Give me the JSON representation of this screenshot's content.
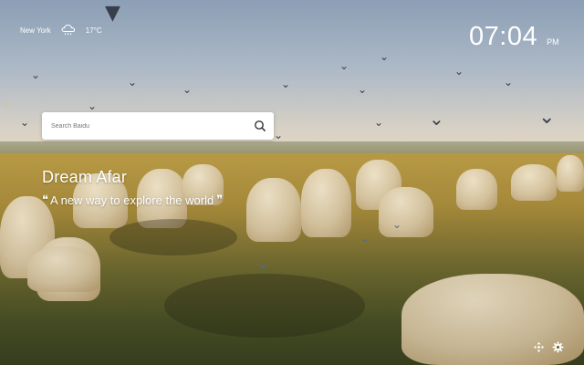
{
  "weather": {
    "city": "New York",
    "icon": "rain-cloud-icon",
    "temperature": "17°C"
  },
  "clock": {
    "time": "07:04",
    "period": "PM"
  },
  "search": {
    "placeholder": "Search Baidu",
    "value": "",
    "icon": "search-icon"
  },
  "brand": {
    "name": "Dream Afar",
    "slogan": "A new way to explore the world",
    "open_quote": "❝",
    "close_quote": "❞"
  },
  "bottom_icons": [
    "move-arrows-icon",
    "gear-icon"
  ],
  "colors": {
    "text": "#ffffff",
    "search_bg": "#ffffff",
    "sky": "#b3bfcc",
    "land": "#a98c3b"
  }
}
